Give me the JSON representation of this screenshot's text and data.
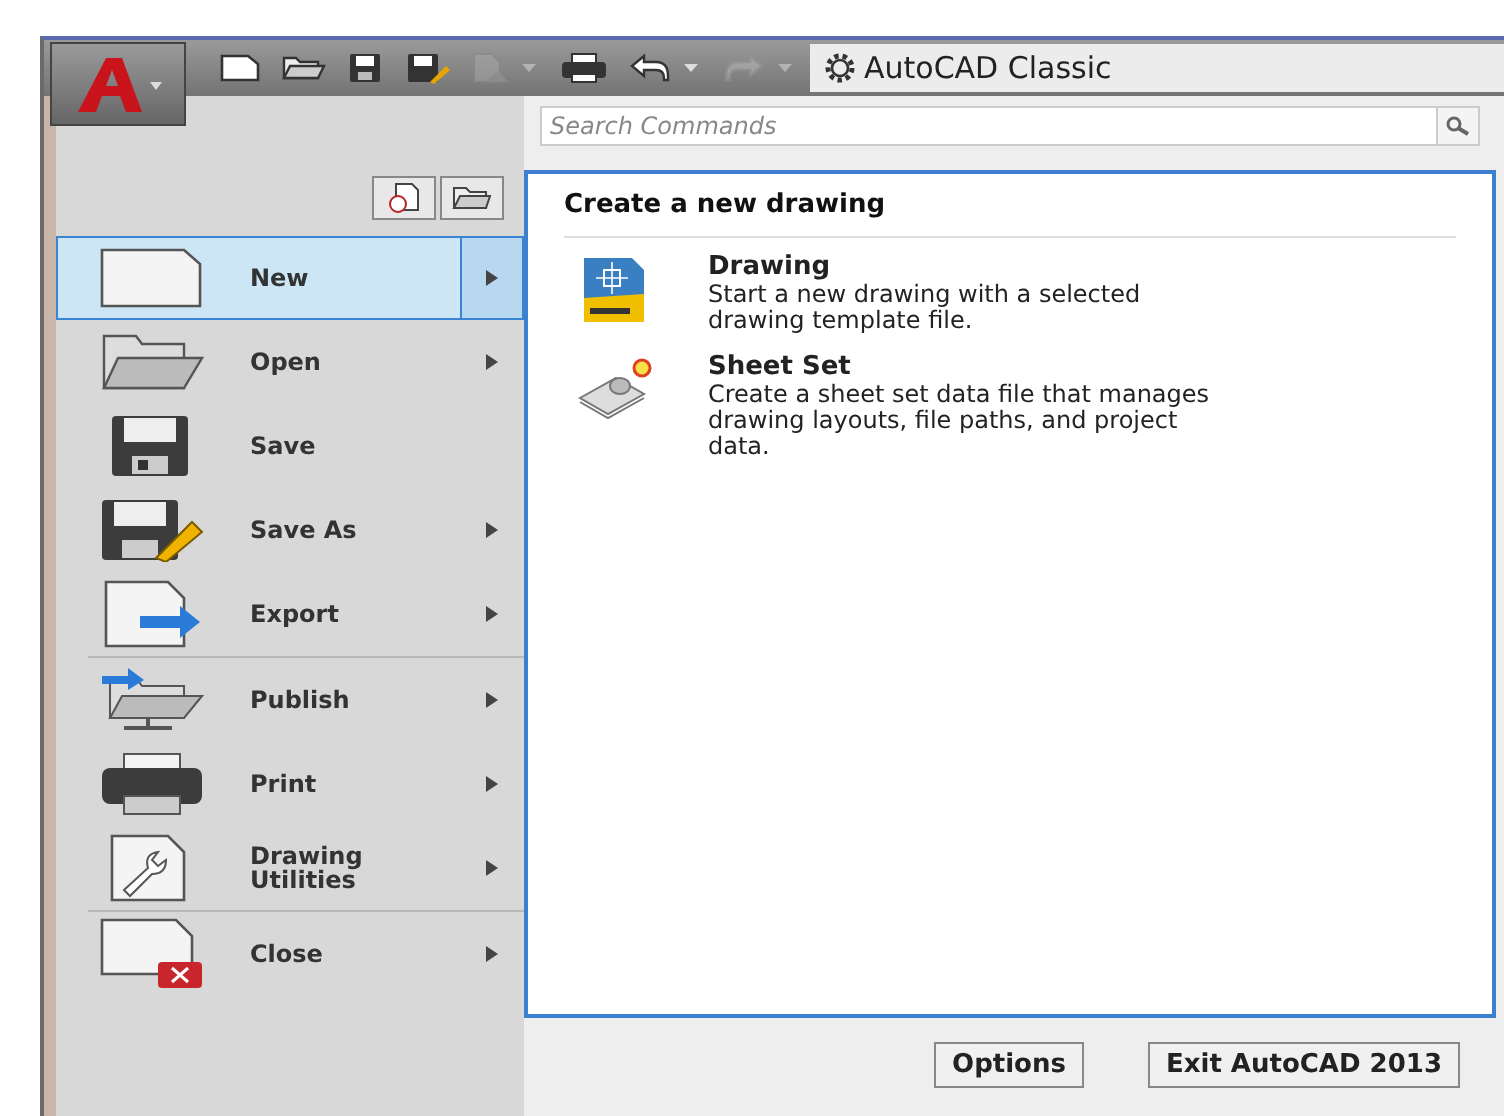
{
  "toolbar": {
    "items": [
      {
        "kind": "new",
        "disabled": false,
        "dropdown": false
      },
      {
        "kind": "open",
        "disabled": false,
        "dropdown": false
      },
      {
        "kind": "save",
        "disabled": false,
        "dropdown": false
      },
      {
        "kind": "saveas",
        "disabled": false,
        "dropdown": false
      },
      {
        "kind": "plot",
        "disabled": true,
        "dropdown": true
      },
      {
        "kind": "print",
        "disabled": false,
        "dropdown": false
      },
      {
        "kind": "undo",
        "disabled": false,
        "dropdown": true
      },
      {
        "kind": "redo",
        "disabled": true,
        "dropdown": true
      }
    ],
    "workspace": "AutoCAD Classic"
  },
  "search": {
    "placeholder": "Search Commands"
  },
  "menu": {
    "groups": [
      [
        {
          "kind": "new",
          "label": "New",
          "selected": true,
          "submenu": true
        },
        {
          "kind": "open",
          "label": "Open",
          "selected": false,
          "submenu": true
        },
        {
          "kind": "save",
          "label": "Save",
          "selected": false,
          "submenu": false
        },
        {
          "kind": "saveas",
          "label": "Save As",
          "selected": false,
          "submenu": true
        },
        {
          "kind": "export",
          "label": "Export",
          "selected": false,
          "submenu": true
        }
      ],
      [
        {
          "kind": "publish",
          "label": "Publish",
          "selected": false,
          "submenu": true
        },
        {
          "kind": "print",
          "label": "Print",
          "selected": false,
          "submenu": true
        },
        {
          "kind": "utilities",
          "label": "Drawing Utilities",
          "selected": false,
          "submenu": true
        }
      ],
      [
        {
          "kind": "close",
          "label": "Close",
          "selected": false,
          "submenu": true
        }
      ]
    ]
  },
  "submenu": {
    "title": "Create a new drawing",
    "items": [
      {
        "kind": "drawing",
        "title": "Drawing",
        "description": "Start a new drawing with a selected drawing template file."
      },
      {
        "kind": "sheetset",
        "title": "Sheet Set",
        "description": "Create a sheet set data file that manages drawing layouts, file paths, and project data."
      }
    ]
  },
  "buttons": [
    "Options",
    "Exit AutoCAD 2013"
  ]
}
